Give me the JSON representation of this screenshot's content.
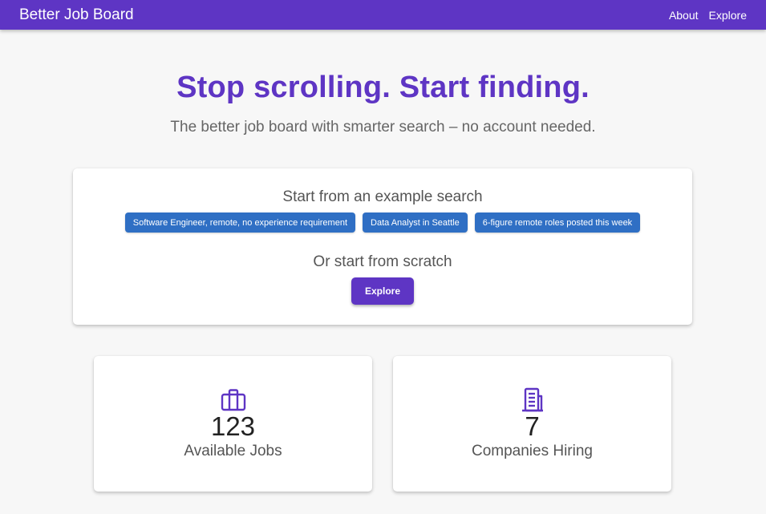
{
  "header": {
    "brand": "Better Job Board",
    "nav": [
      "About",
      "Explore"
    ],
    "bar_color": "#5e35c4"
  },
  "hero": {
    "title": "Stop scrolling. Start finding.",
    "subtitle": "The better job board with smarter search – no account needed."
  },
  "search_card": {
    "example_heading": "Start from an example search",
    "examples": [
      "Software Engineer, remote, no experience requirement",
      "Data Analyst in Seattle",
      "6-figure remote roles posted this week"
    ],
    "scratch_heading": "Or start from scratch",
    "explore_label": "Explore"
  },
  "stats": [
    {
      "icon": "briefcase-icon",
      "value": "123",
      "label": "Available Jobs"
    },
    {
      "icon": "building-icon",
      "value": "7",
      "label": "Companies Hiring"
    }
  ],
  "colors": {
    "primary": "#5e35c4",
    "chip": "#2f6fc4",
    "background": "#f7f7f7"
  }
}
